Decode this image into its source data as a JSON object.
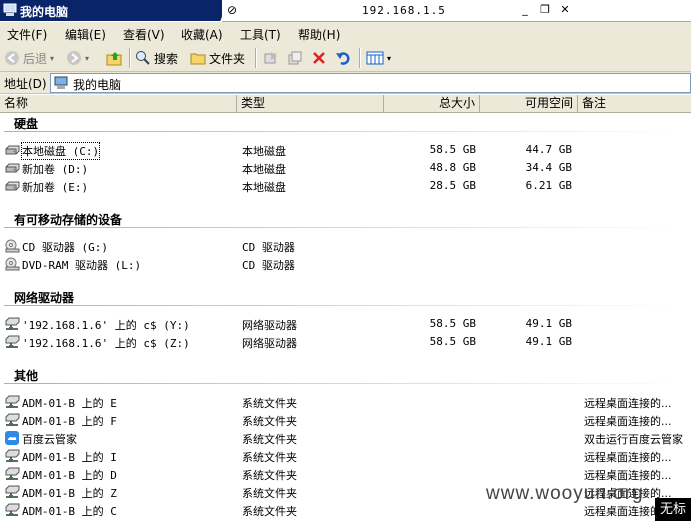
{
  "window": {
    "title": "我的电脑",
    "remote_address": "192.168.1.5",
    "pin_glyph": "⊘",
    "minimize_glyph": "_",
    "restore_glyph": "❐",
    "close_glyph": "✕"
  },
  "menu": [
    "文件(F)",
    "编辑(E)",
    "查看(V)",
    "收藏(A)",
    "工具(T)",
    "帮助(H)"
  ],
  "toolbar": {
    "back_label": "后退",
    "search_label": "搜索",
    "folders_label": "文件夹"
  },
  "address": {
    "label": "地址(D)",
    "value": "我的电脑"
  },
  "columns": {
    "name": "名称",
    "type": "类型",
    "total": "总大小",
    "free": "可用空间",
    "note": "备注"
  },
  "groups": {
    "hard_disks": "硬盘",
    "removable": "有可移动存储的设备",
    "network": "网络驱动器",
    "other": "其他"
  },
  "hard_disks": [
    {
      "name": "本地磁盘 (C:)",
      "type": "本地磁盘",
      "total": "58.5 GB",
      "free": "44.7 GB",
      "icon": "hard-drive-icon"
    },
    {
      "name": "新加卷 (D:)",
      "type": "本地磁盘",
      "total": "48.8 GB",
      "free": "34.4 GB",
      "icon": "hard-drive-icon"
    },
    {
      "name": "新加卷 (E:)",
      "type": "本地磁盘",
      "total": "28.5 GB",
      "free": "6.21 GB",
      "icon": "hard-drive-icon"
    }
  ],
  "removable": [
    {
      "name": "CD 驱动器 (G:)",
      "type": "CD 驱动器",
      "icon": "cd-drive-icon"
    },
    {
      "name": "DVD-RAM 驱动器 (L:)",
      "type": "CD 驱动器",
      "icon": "cd-drive-icon"
    }
  ],
  "network": [
    {
      "name": "'192.168.1.6' 上的 c$ (Y:)",
      "type": "网络驱动器",
      "total": "58.5 GB",
      "free": "49.1 GB",
      "icon": "network-drive-icon"
    },
    {
      "name": "'192.168.1.6' 上的 c$ (Z:)",
      "type": "网络驱动器",
      "total": "58.5 GB",
      "free": "49.1 GB",
      "icon": "network-drive-icon"
    }
  ],
  "other": [
    {
      "name": "ADM-01-B 上的 E",
      "type": "系统文件夹",
      "note": "远程桌面连接的...",
      "icon": "network-drive-icon"
    },
    {
      "name": "ADM-01-B 上的 F",
      "type": "系统文件夹",
      "note": "远程桌面连接的...",
      "icon": "network-drive-icon"
    },
    {
      "name": "百度云管家",
      "type": "系统文件夹",
      "note": "双击运行百度云管家",
      "icon": "baidu-cloud-icon"
    },
    {
      "name": "ADM-01-B 上的 I",
      "type": "系统文件夹",
      "note": "远程桌面连接的...",
      "icon": "network-drive-icon"
    },
    {
      "name": "ADM-01-B 上的 D",
      "type": "系统文件夹",
      "note": "远程桌面连接的...",
      "icon": "network-drive-icon"
    },
    {
      "name": "ADM-01-B 上的 Z",
      "type": "系统文件夹",
      "note": "远程桌面连接的...",
      "icon": "network-drive-icon"
    },
    {
      "name": "ADM-01-B 上的 C",
      "type": "系统文件夹",
      "note": "远程桌面连接的...",
      "icon": "network-drive-icon"
    }
  ],
  "overlay": {
    "watermark": "www.wooyun.org",
    "corner_text": "无标"
  }
}
